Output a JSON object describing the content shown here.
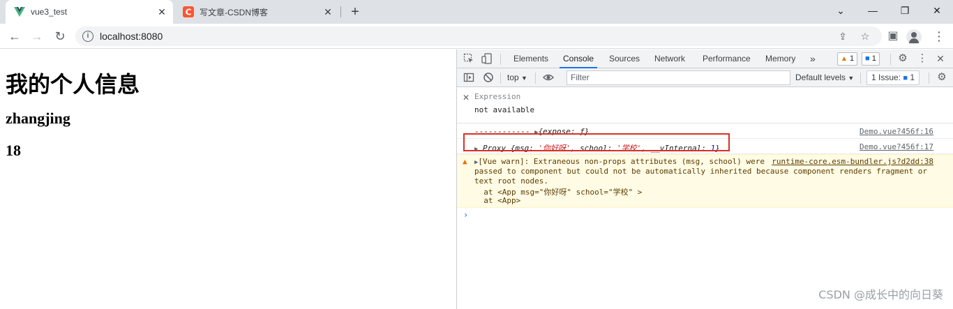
{
  "browser": {
    "tabs": [
      {
        "title": "vue3_test",
        "active": true,
        "favicon": "vue-logo-icon"
      },
      {
        "title": "写文章-CSDN博客",
        "active": false,
        "favicon": "csdn-logo-icon"
      }
    ],
    "address": "localhost:8080",
    "accent": "#1a73e8"
  },
  "page": {
    "heading": "我的个人信息",
    "name": "zhangjing",
    "age": "18"
  },
  "devtools": {
    "tabs": [
      "Elements",
      "Console",
      "Sources",
      "Network",
      "Performance",
      "Memory"
    ],
    "selected_tab": "Console",
    "more_tabs": "»",
    "warning_count": "1",
    "info_count": "1",
    "context": "top",
    "filter_placeholder": "Filter",
    "levels": "Default levels",
    "issues_label": "1 Issue:",
    "issues_count": "1",
    "expression": {
      "label": "Expression",
      "value": "not available"
    },
    "logs": [
      {
        "prefix": "------------ ",
        "body": "{expose: ƒ}",
        "source": "Demo.vue?456f:16"
      },
      {
        "proxy_label": "Proxy",
        "open": "{",
        "k1": "msg",
        "v1": "'你好呀'",
        "k2": "school",
        "v2": "'学校'",
        "k3": "__vInternal",
        "v3": "1",
        "close": "}",
        "source": "Demo.vue?456f:17"
      }
    ],
    "warning": {
      "line1": "[Vue warn]: Extraneous non-props attributes (msg, school) were",
      "source": "runtime-core.esm-bundler.js?d2dd:38",
      "line2": "passed to component but could not be automatically inherited because component renders fragment or",
      "line3": "text root nodes.",
      "line4": "  at <App msg=\"你好呀\" school=\"学校\" >",
      "line5": "  at <App>"
    },
    "prompt": "›",
    "highlight_color": "#d93025"
  },
  "watermark": "CSDN @成长中的向日葵"
}
